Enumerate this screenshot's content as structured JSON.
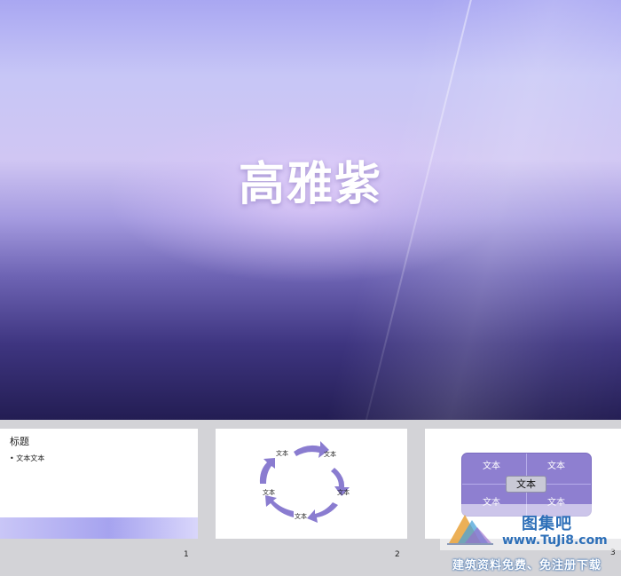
{
  "main_slide": {
    "title": "高雅紫"
  },
  "thumbnails": [
    {
      "title": "标题",
      "bullet": "• 文本文本",
      "page": "1"
    },
    {
      "cycle_labels": [
        "文本",
        "文本",
        "文本",
        "文本",
        "文本"
      ],
      "page": "2"
    },
    {
      "cells": [
        "文本",
        "文本",
        "文本",
        "文本"
      ],
      "center": "文本",
      "page": "3"
    }
  ],
  "watermark": {
    "brand": "图集吧",
    "url": "www.TuJi8.com",
    "slogan": "建筑资料免费、免注册下载"
  },
  "colors": {
    "accent_purple": "#8e7fd0",
    "arrow_purple": "#8a7cd0"
  }
}
